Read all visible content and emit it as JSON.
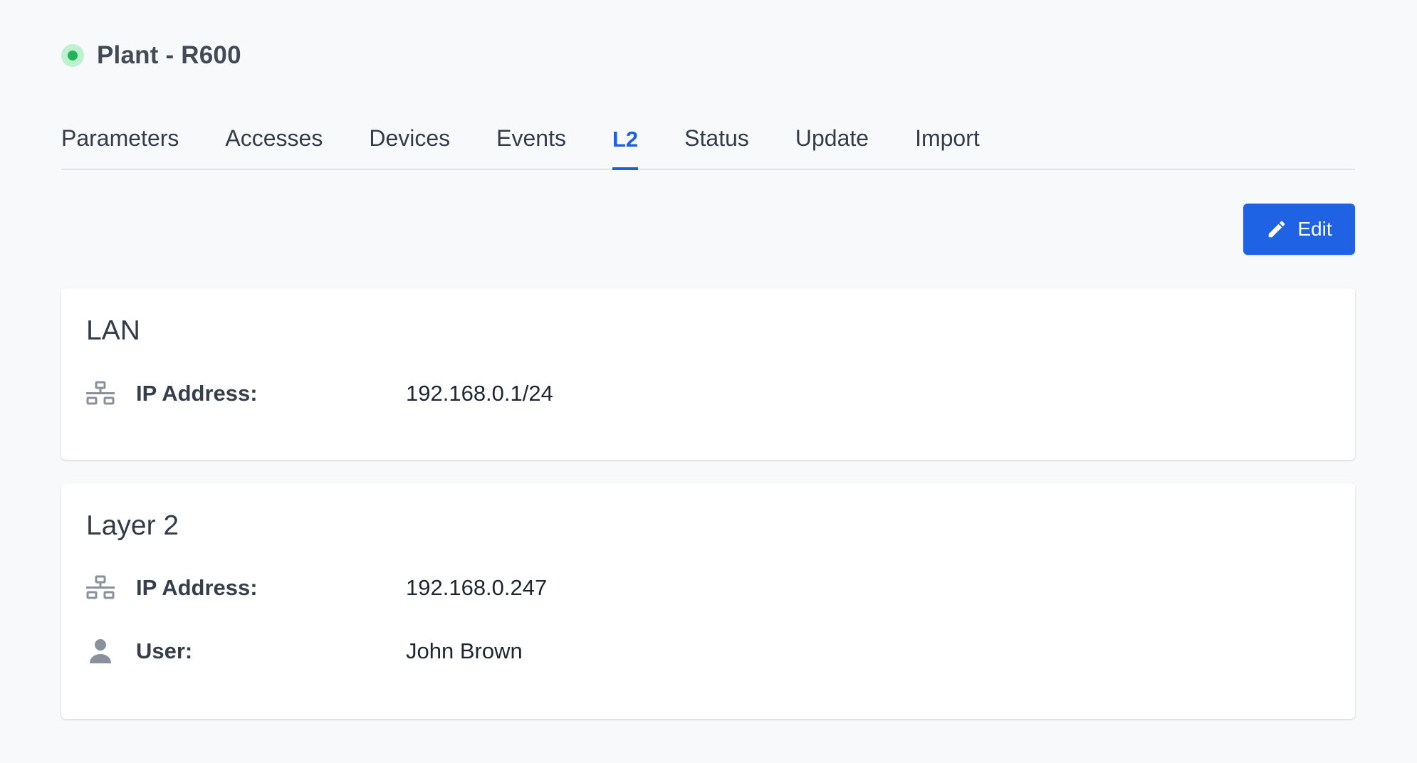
{
  "header": {
    "title": "Plant - R600",
    "status_color": "#20b45a"
  },
  "tabs": [
    {
      "label": "Parameters",
      "active": false
    },
    {
      "label": "Accesses",
      "active": false
    },
    {
      "label": "Devices",
      "active": false
    },
    {
      "label": "Events",
      "active": false
    },
    {
      "label": "L2",
      "active": true
    },
    {
      "label": "Status",
      "active": false
    },
    {
      "label": "Update",
      "active": false
    },
    {
      "label": "Import",
      "active": false
    }
  ],
  "toolbar": {
    "edit_label": "Edit",
    "edit_icon": "pencil-icon",
    "accent_color": "#1f62e3"
  },
  "lan": {
    "title": "LAN",
    "rows": [
      {
        "icon": "network-icon",
        "label": "IP Address:",
        "value": "192.168.0.1/24"
      }
    ]
  },
  "layer2": {
    "title": "Layer 2",
    "rows": [
      {
        "icon": "network-icon",
        "label": "IP Address:",
        "value": "192.168.0.247"
      },
      {
        "icon": "user-icon",
        "label": "User:",
        "value": "John Brown"
      }
    ]
  }
}
